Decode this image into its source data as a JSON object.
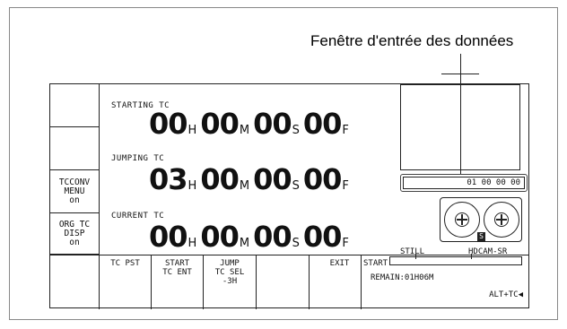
{
  "caption": "Fenêtre d'entrée des données",
  "side_buttons": [
    {
      "lines": [
        "",
        "",
        ""
      ]
    },
    {
      "lines": [
        "",
        "",
        ""
      ]
    },
    {
      "lines": [
        "TCCONV",
        "MENU",
        "on"
      ]
    },
    {
      "lines": [
        "ORG TC",
        "DISP",
        "on"
      ]
    },
    {
      "lines": [
        "",
        "",
        ""
      ]
    }
  ],
  "timecodes": [
    {
      "label": "STARTING TC",
      "hh": "00",
      "mm": "00",
      "ss": "00",
      "ff": "00"
    },
    {
      "label": "JUMPING  TC",
      "hh": "03",
      "mm": "00",
      "ss": "00",
      "ff": "00"
    },
    {
      "label": "CURRENT  TC",
      "hh": "00",
      "mm": "00",
      "ss": "00",
      "ff": "00"
    }
  ],
  "units": {
    "h": "H",
    "m": "M",
    "s": "S",
    "f": "F"
  },
  "data_entry_value": "01 00 00 00",
  "tape_badge": "S",
  "status": {
    "mode": "STILL",
    "format": "HDCAM-SR"
  },
  "fkeys": [
    {
      "lines": [
        "",
        "",
        ""
      ]
    },
    {
      "lines": [
        "",
        "TC PST",
        ""
      ]
    },
    {
      "lines": [
        "START",
        "TC ENT",
        ""
      ]
    },
    {
      "lines": [
        "JUMP",
        "TC SEL",
        "-3H"
      ]
    },
    {
      "lines": [
        "",
        "",
        ""
      ]
    },
    {
      "lines": [
        "EXIT",
        "",
        ""
      ]
    }
  ],
  "start_label": "START",
  "remain": "REMAIN:01H06M",
  "alt_hint": "ALT+TC◀"
}
